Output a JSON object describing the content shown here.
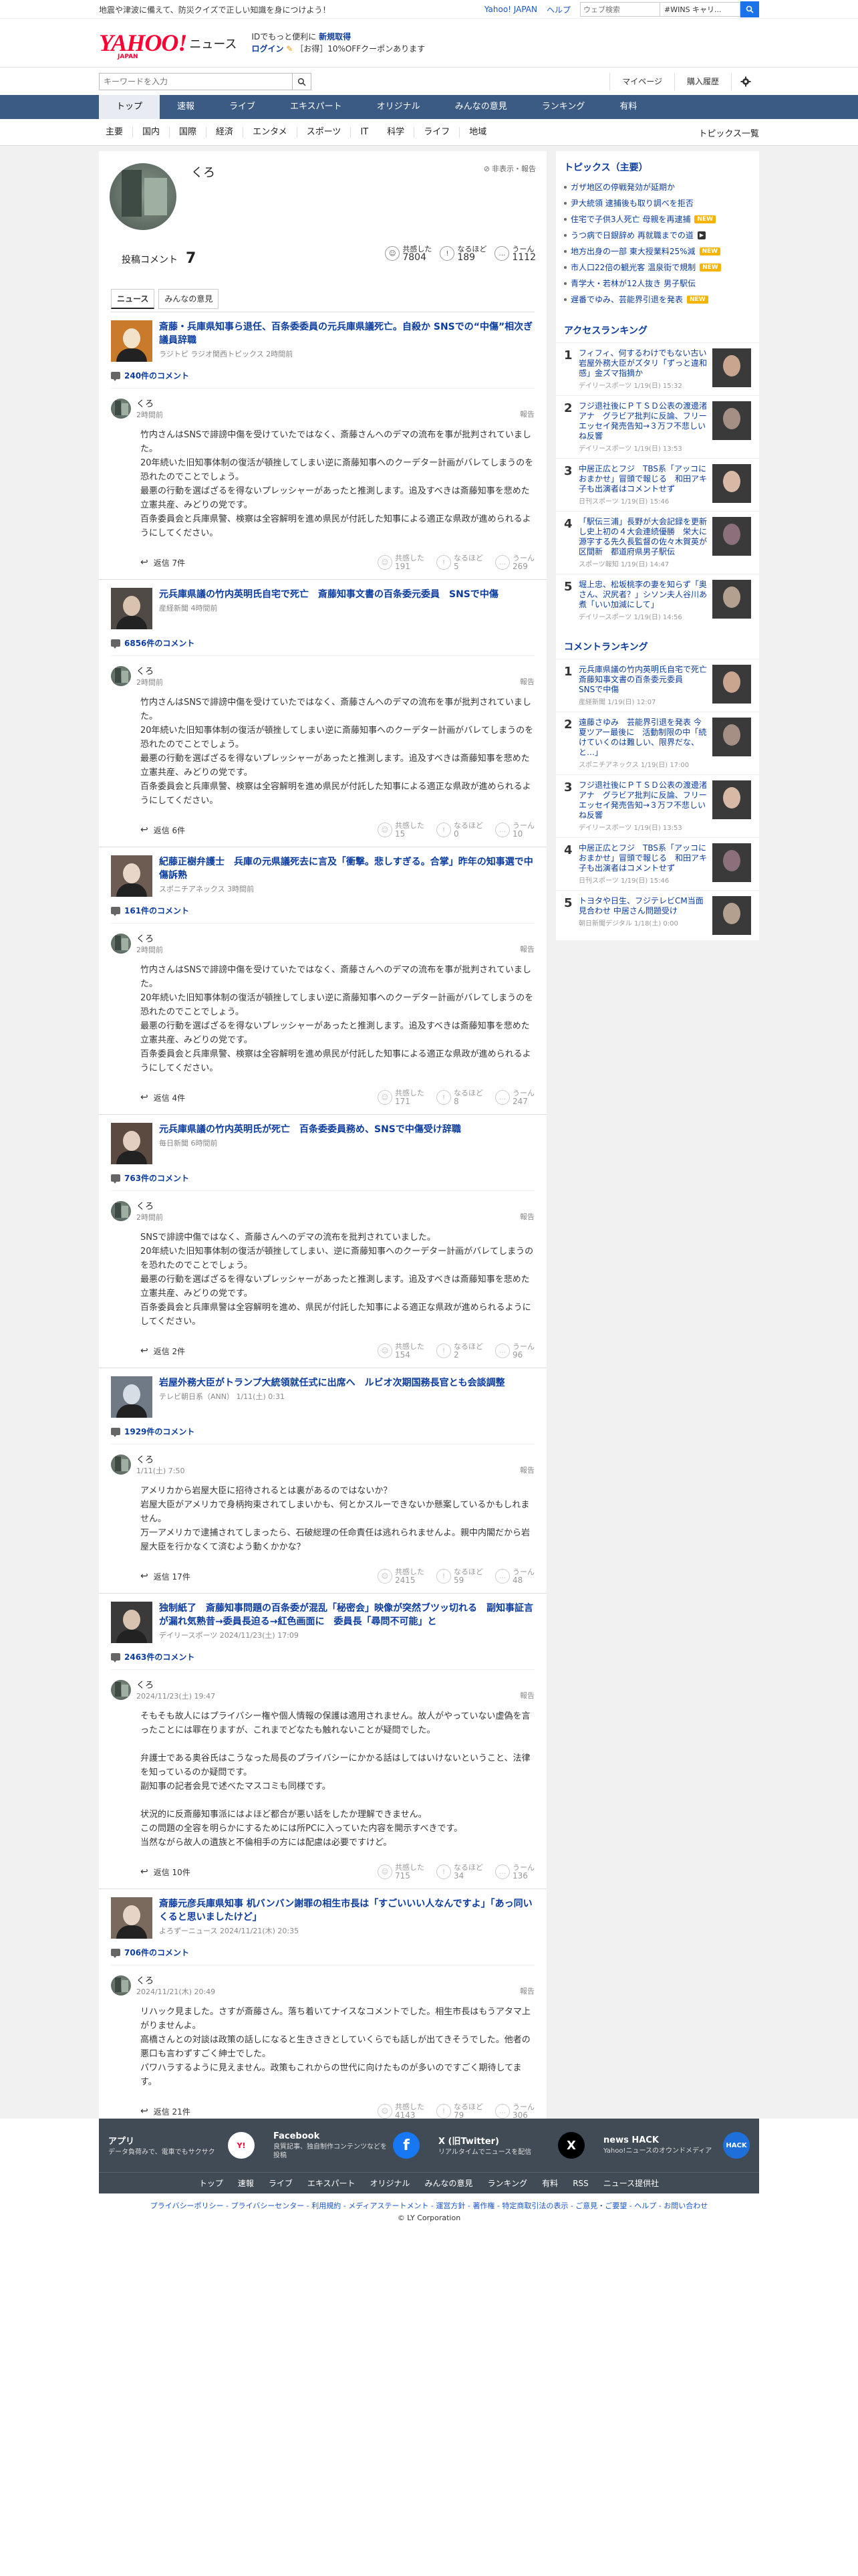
{
  "top_strip": {
    "notice": "地震や津波に備えて、防災クイズで正しい知識を身につけよう！",
    "links": [
      "Yahoo! JAPAN",
      "ヘルプ"
    ],
    "search_placeholder": "ウェブ検索",
    "search_tag": "#WINS キャリ..."
  },
  "header": {
    "logo_text": "YAHOO!",
    "logo_sub": "JAPAN",
    "logo_news": "ニュース",
    "promo_line1_prefix": "IDでもっと便利に",
    "promo_line1_link": "新規取得",
    "promo_line2_link": "ログイン",
    "promo_line2_text": "［お得］10%OFFクーポンあります"
  },
  "searchbar": {
    "placeholder": "キーワードを入力",
    "mypage": "マイページ",
    "purchase": "購入履歴"
  },
  "mainnav": [
    "トップ",
    "速報",
    "ライブ",
    "エキスパート",
    "オリジナル",
    "みんなの意見",
    "ランキング",
    "有料"
  ],
  "subnav": [
    "主要",
    "国内",
    "国際",
    "経済",
    "エンタメ",
    "スポーツ",
    "IT",
    "科学",
    "ライフ",
    "地域"
  ],
  "subnav_right": "トピックス一覧",
  "profile": {
    "name": "くろ",
    "block_label": "非表示・報告",
    "comments_label": "投稿コメント",
    "comments_count": "7",
    "stats": [
      {
        "label": "共感した",
        "value": "7804"
      },
      {
        "label": "なるほど",
        "value": "189"
      },
      {
        "label": "うーん",
        "value": "1112"
      }
    ],
    "tabs": [
      "ニュース",
      "みんなの意見"
    ]
  },
  "vote_labels": {
    "a": "共感した",
    "b": "なるほど",
    "c": "うーん",
    "reply": "返信"
  },
  "comments": [
    {
      "title": "斎藤・兵庫県知事ら退任、百条委委員の元兵庫県議死亡。自殺か SNSでの“中傷”相次ぎ議員辞職",
      "source": "ラジトピ ラジオ関西トピックス 2時間前",
      "count": "240件のコメント",
      "user": "くろ",
      "time": "2時間前",
      "report": "報告",
      "body": "竹内さんはSNSで誹謗中傷を受けていたではなく、斎藤さんへのデマの流布を事が批判されていました。\n20年続いた旧知事体制の復活が頓挫してしまい逆に斎藤知事へのクーデター計画がバレてしまうのを恐れたのでことでしょう。\n最悪の行動を選ばざるを得ないプレッシャーがあったと推測します。追及すべきは斎藤知事を悲めた立憲共産、みどりの党です。\n百条委員会と兵庫県警、検察は全容解明を進め県民が付託した知事による適正な県政が進められるようにしてください。",
      "reply": "返信 7件",
      "v": [
        "191",
        "5",
        "269"
      ]
    },
    {
      "title": "元兵庫県議の竹内英明氏自宅で死亡　斎藤知事文書の百条委元委員　SNSで中傷",
      "source": "産経新聞 4時間前",
      "count": "6856件のコメント",
      "user": "くろ",
      "time": "2時間前",
      "report": "報告",
      "body": "竹内さんはSNSで誹謗中傷を受けていたではなく、斎藤さんへのデマの流布を事が批判されていました。\n20年続いた旧知事体制の復活が頓挫してしまい逆に斎藤知事へのクーデター計画がバレてしまうのを恐れたのでことでしょう。\n最悪の行動を選ばざるを得ないプレッシャーがあったと推測します。追及すべきは斎藤知事を悲めた立憲共産、みどりの党です。\n百条委員会と兵庫県警、検察は全容解明を進め県民が付託した知事による適正な県政が進められるようにしてください。",
      "reply": "返信 6件",
      "v": [
        "15",
        "0",
        "10"
      ]
    },
    {
      "title": "紀藤正樹弁護士　兵庫の元県議死去に言及「衝撃。悲しすぎる。合掌」昨年の知事選で中傷訴熟",
      "source": "スポニチアネックス 3時間前",
      "count": "161件のコメント",
      "user": "くろ",
      "time": "2時間前",
      "report": "報告",
      "body": "竹内さんはSNSで誹謗中傷を受けていたではなく、斎藤さんへのデマの流布を事が批判されていました。\n20年続いた旧知事体制の復活が頓挫してしまい逆に斎藤知事へのクーデター計画がバレてしまうのを恐れたのでことでしょう。\n最悪の行動を選ばざるを得ないプレッシャーがあったと推測します。追及すべきは斎藤知事を悲めた立憲共産、みどりの党です。\n百条委員会と兵庫県警、検察は全容解明を進め県民が付託した知事による適正な県政が進められるようにしてください。",
      "reply": "返信 4件",
      "v": [
        "171",
        "8",
        "247"
      ]
    },
    {
      "title": "元兵庫県議の竹内英明氏が死亡　百条委委員務め、SNSで中傷受け辞職",
      "source": "毎日新聞 6時間前",
      "count": "763件のコメント",
      "user": "くろ",
      "time": "2時間前",
      "report": "報告",
      "body": "SNSで誹謗中傷ではなく、斎藤さんへのデマの流布を批判されていました。\n20年続いた旧知事体制の復活が頓挫してしまい、逆に斎藤知事へのクーデター計画がバレてしまうのを恐れたのでことでしょう。\n最悪の行動を選ばざるを得ないプレッシャーがあったと推測します。追及すべきは斎藤知事を悲めた立憲共産、みどりの党です。\n百条委員会と兵庫県警は全容解明を進め、県民が付託した知事による適正な県政が進められるようにしてください。",
      "reply": "返信 2件",
      "v": [
        "154",
        "2",
        "96"
      ]
    },
    {
      "title": "岩屋外務大臣がトランプ大統領就任式に出席へ　ルビオ次期国務長官とも会談調整",
      "source": "テレビ朝日系（ANN） 1/11(土) 0:31",
      "count": "1929件のコメント",
      "user": "くろ",
      "time": "1/11(土) 7:50",
      "report": "報告",
      "body": "アメリカから岩屋大臣に招待されるとは裏があるのではないか？\n岩屋大臣がアメリカで身柄拘束されてしまいかも、何とかスルーできないか懸案しているかもしれません。\n万一アメリカで逮捕されてしまったら、石破総理の任命責任は逃れられませんよ。親中内閣だから岩屋大臣を行かなくて済むよう動くかかな？",
      "reply": "返信 17件",
      "v": [
        "2415",
        "59",
        "48"
      ]
    },
    {
      "title": "独制紙了　斎藤知事問題の百条委が混乱「秘密会」映像が突然ブツッ切れる　副知事証言が漏れ気熟昔→委員長迫る→紅色画面に　委員長「尋問不可能」と",
      "source": "デイリースポーツ 2024/11/23(土) 17:09",
      "count": "2463件のコメント",
      "user": "くろ",
      "time": "2024/11/23(土) 19:47",
      "report": "報告",
      "body": "そもそも故人にはプライバシー権や個人情報の保護は適用されません。故人がやっていない虚偽を言ったことには罪在りますが、これまでどなたも触れないことが疑問でした。\n\n弁護士である奥谷氏はこうなった局長のプライバシーにかかる話はしてはいけないということ、法律を知っているのか疑問です。\n副知事の記者会見で述べたマスコミも同様です。\n\n状況的に反斎藤知事派にはよほど都合が悪い話をしたか理解できません。\nこの問題の全容を明らかにするためには所PCに入っていた内容を開示すべきです。\n当然ながら故人の遺族と不倫相手の方には配慮は必要ですけど。",
      "reply": "返信 10件",
      "v": [
        "715",
        "34",
        "136"
      ]
    },
    {
      "title": "斎藤元彦兵庫県知事 机バンバン謝罪の相生市長は「すごいいい人なんですよ」「あっ同いくると思いましたけど」",
      "source": "よろずーニュース 2024/11/21(木) 20:35",
      "count": "706件のコメント",
      "user": "くろ",
      "time": "2024/11/21(木) 20:49",
      "report": "報告",
      "body": "リハック見ました。さすが斎藤さん。落ち着いてナイスなコメントでした。相生市長はもうアタマ上がりませんよ。\n高橋さんとの対談は政策の話しになると生きさきとしていくらでも話しが出てきそうでした。他者の悪口も言わずすごく紳士でした。\nパワハラするように見えません。政策もこれからの世代に向けたものが多いのですごく期待してます。",
      "reply": "返信 21件",
      "v": [
        "4143",
        "79",
        "306"
      ]
    }
  ],
  "sidebar": {
    "topics_title": "トピックス（主要）",
    "topics": [
      {
        "t": "ガザ地区の停戦発効が延期か",
        "badge": ""
      },
      {
        "t": "尹大統領 逮捕後も取り調べを拒否",
        "badge": ""
      },
      {
        "t": "住宅で子供3人死亡 母親を再逮捕",
        "badge": "new"
      },
      {
        "t": "うつ病で日銀辞め 再就職までの道",
        "badge": "vid"
      },
      {
        "t": "地方出身の一部 東大授業料25%減",
        "badge": "new"
      },
      {
        "t": "市人口22倍の観光客 温泉街で規制",
        "badge": "new"
      },
      {
        "t": "青学大・若林が12人抜き 男子駅伝",
        "badge": ""
      },
      {
        "t": "遅番でゆみ、芸能界引退を発表",
        "badge": "new"
      }
    ],
    "access_title": "アクセスランキング",
    "access": [
      {
        "n": "1",
        "t": "フィフィ、何するわけでもない古い岩屋外務大臣がズタリ「ずっと違和感」金ズマ指摘か",
        "s": "デイリースポーツ 1/19(日) 15:32"
      },
      {
        "n": "2",
        "t": "フジ退社後にＰＴＳＤ公表の渡邊渚アナ　グラビア批判に反論、フリーエッセイ発売告知→３万フ不悲しいね反響",
        "s": "デイリースポーツ 1/19(日) 13:53"
      },
      {
        "n": "3",
        "t": "中居正広とフジ　TBS系「アッコにおまかせ」冒頭で報じる　和田アキ子も出演者はコメントせず",
        "s": "日刊スポーツ 1/19(日) 15:46"
      },
      {
        "n": "4",
        "t": "「駅伝三浦」長野が大会記録を更新し史上初の４大会連続優勝　栄大に源字する先久長監督の佐々木賀英が区間新　都道府県男子駅伝",
        "s": "スポーツ報知 1/19(日) 14:47"
      },
      {
        "n": "5",
        "t": "堀上忠、松坂桃李の妻を知らず「奥さん、沢尻者？」シソン夫人谷川あ煮「いい加減にして」",
        "s": "デイリースポーツ 1/19(日) 14:56"
      }
    ],
    "comment_title": "コメントランキング",
    "commentrank": [
      {
        "n": "1",
        "t": "元兵庫県議の竹内英明氏自宅で死亡　斎藤知事文書の百条委元委員　SNSで中傷",
        "s": "産経新聞 1/19(日) 12:07"
      },
      {
        "n": "2",
        "t": "遠藤さゆみ　芸能界引退を発表 今夏ツアー最後に　活動制限の中「続けていくのは難しい、限界だな、と…」",
        "s": "スポニチアネックス 1/19(日) 17:00"
      },
      {
        "n": "3",
        "t": "フジ退社後にＰＴＳＤ公表の渡邊渚アナ　グラビア批判に反論、フリーエッセイ発売告知→３万フ不悲しいね反響",
        "s": "デイリースポーツ 1/19(日) 13:53"
      },
      {
        "n": "4",
        "t": "中居正広とフジ　TBS系「アッコにおまかせ」冒頭で報じる　和田アキ子も出演者はコメントせず",
        "s": "日刊スポーツ 1/19(日) 15:46"
      },
      {
        "n": "5",
        "t": "トヨタや日生、フジテレビCM当面見合わせ 中居さん問題受け",
        "s": "朝日新聞デジタル 1/18(土) 0:00"
      }
    ]
  },
  "footer": {
    "apps": [
      {
        "title": "アプリ",
        "desc": "データ負荷みで、電車でもサクサク",
        "icon": "Y!"
      },
      {
        "title": "Facebook",
        "desc": "良質記事、独自制作コンテンツなどを投稿",
        "icon": "f"
      },
      {
        "title": "X (旧Twitter)",
        "desc": "リアルタイムでニュースを配信",
        "icon": "X"
      },
      {
        "title": "news HACK",
        "desc": "Yahoo!ニュースのオウンドメディア",
        "icon": "HACK"
      }
    ],
    "nav": [
      "トップ",
      "速報",
      "ライブ",
      "エキスパート",
      "オリジナル",
      "みんなの意見",
      "ランキング",
      "有料",
      "RSS",
      "ニュース提供社"
    ],
    "links": "プライバシーポリシー - プライバシーセンター - 利用規約 - メディアステートメント - 運営方針 - 著作権 - 特定商取引法の表示 - ご意見・ご要望 - ヘルプ - お問い合わせ",
    "copyright": "© LY Corporation"
  }
}
